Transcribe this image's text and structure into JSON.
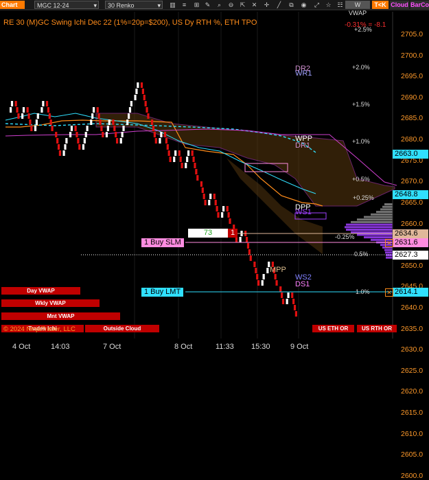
{
  "toolbar": {
    "chart_label": "Chart",
    "instrument": "MGC 12-24",
    "bar_type": "30 Renko",
    "buttons": [
      "W VWAP",
      "T<K",
      "Cloud",
      "BarCo"
    ]
  },
  "header": {
    "title": "RE 30 (M)GC Swing Ichi Dec 22 (1%=20p=$200), US Dy RTH %, ETH TPO",
    "change": "-0.31% = -8.1"
  },
  "y_axis": [
    "2705.0",
    "2700.0",
    "2695.0",
    "2690.0",
    "2685.0",
    "2680.0",
    "2675.0",
    "2670.0",
    "2665.0",
    "2660.0",
    "2655.0",
    "2650.0",
    "2645.0",
    "2640.0",
    "2635.0",
    "2630.0",
    "2625.0",
    "2620.0",
    "2615.0",
    "2610.0",
    "2605.0",
    "2600.0"
  ],
  "x_axis": [
    "4 Oct",
    "14:03",
    "7 Oct",
    "8 Oct",
    "11:33",
    "15:30",
    "9 Oct"
  ],
  "pct_levels": [
    "+2.5%",
    "+2.0%",
    "+1.5%",
    "+1.0%",
    "+0.5%",
    "+0.25%",
    "-0.25%",
    "0.5%",
    "1.0%"
  ],
  "pivots": [
    "DR2",
    "WR1",
    "WPP",
    "DR1",
    "DPP",
    "WS1",
    "MPP",
    "WS2",
    "DS1"
  ],
  "price_boxes": {
    "p1": "2663.0",
    "p2": "2648.8",
    "p3": "2634.6",
    "p4": "2631.6",
    "p5": "2627.3",
    "p6": "2614.1"
  },
  "orders": {
    "qty": "73",
    "qty_badge": "1",
    "buy_slm": "1 Buy SLM",
    "buy_lmt": "1 Buy LMT"
  },
  "panel_buttons": {
    "day_vwap": "Day VWAP",
    "wkly_vwap": "Wkly VWAP",
    "mnt_vwap": "Mnt VWAP",
    "trades_ichi": "Trades Ichi",
    "outside_cloud": "Outside Cloud",
    "us_eth_or": "US ETH OR",
    "us_rth_or": "US RTH OR"
  },
  "copyright": "© 2024 NinjaTrader, LLC",
  "colors": {
    "up_brick": "#ffffff",
    "down_brick": "#e01010",
    "price_axis": "#ff9a2a",
    "cloud_fill": "#5a3a10",
    "kijun": "#ff8c1a",
    "tenkan": "#30e0ff",
    "profile": "#a040ff"
  }
}
